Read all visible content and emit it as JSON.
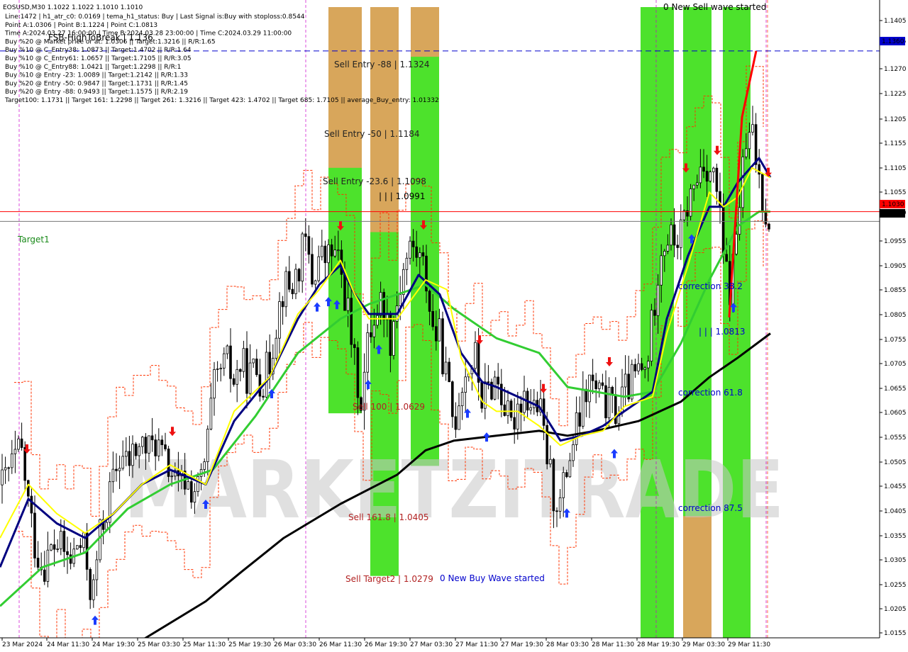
{
  "header": {
    "symbol_line": "EOSUSD,M30  1.1022 1.1022 1.1010 1.1010",
    "info_lines": [
      "Line:1472  |  h1_atr_c0: 0.0169  |  tema_h1_status: Buy  |  Last Signal is:Buy with stoploss:0.8544",
      "Point A:1.0306  |  Point B:1.1224  |  Point C:1.0813",
      "Time A:2024.03.27 16:00:00  |  Time B:2024.03.28 23:00:00  |  Time C:2024.03.29 11:00:00",
      "Buy %20 @ Market price or at: 1.0306  ||  Target:1.3216  ||  R/R:1.65",
      "Buy %10 @ C_Entry38: 1.0873  ||  Target:1.4702  ||  R/R:1.64",
      "Buy %10 @ C_Entry61: 1.0657  ||  Target:1.7105  ||  R/R:3.05",
      "Buy %10 @ C_Entry88: 1.0421  ||  Target:1.2298  ||  R/R:1",
      "Buy %10 @ Entry -23: 1.0089  ||  Target:1.2142  ||  R/R:1.33",
      "Buy %20 @ Entry -50: 0.9847  ||  Target:1.1731  ||  R/R:1.45",
      "Buy %20 @ Entry -88: 0.9493  ||  Target:1.1575  ||  R/R:2.19",
      "Target100: 1.1731  ||  Target 161: 1.2298  ||  Target 261: 1.3216  ||  Target 423: 1.4702  ||  Target 685: 1.7105  ||  average_Buy_entry: 1.01332"
    ]
  },
  "watermark": "MARKETZITRADE",
  "colors": {
    "bull_zone": "#3ee01a",
    "bear_zone": "#e8a060",
    "yellow_ma": "#ffff00",
    "navy_ma": "#000080",
    "green_ma": "#32cd32",
    "black_ma": "#000000",
    "channel": "#ff3300",
    "candle": "#000000",
    "hline_red": "#ff0000",
    "hline_blue": "#0000cc"
  },
  "annotations": [
    {
      "text": "0 New Sell wave started",
      "color": "#000000"
    },
    {
      "text": "Sell Entry -88 | 1.1324",
      "color": "#222222"
    },
    {
      "text": "Sell Entry -50 | 1.1184",
      "color": "#222222"
    },
    {
      "text": "Sell Entry -23.6 | 1.1098",
      "color": "#222222"
    },
    {
      "text": "| | | 1.0991",
      "color": "#000000"
    },
    {
      "text": "Target1",
      "color": "#1a8a1a"
    },
    {
      "text": "Sell 100 | 1.0629",
      "color": "#b22222"
    },
    {
      "text": "Sell 161.8 | 1.0405",
      "color": "#b22222"
    },
    {
      "text": "Sell Target2 | 1.0279",
      "color": "#b22222"
    },
    {
      "text": "0 New Buy Wave started",
      "color": "#0000cc"
    },
    {
      "text": "correction 38.2",
      "color": "#0000cc"
    },
    {
      "text": "| | | 1.0813",
      "color": "#0000cc"
    },
    {
      "text": "correction 61.8",
      "color": "#0000cc"
    },
    {
      "text": "correction 87.5",
      "color": "#0000cc"
    },
    {
      "text": "FSB-HighToBreak | 1.136",
      "color": "#000000"
    }
  ],
  "price_tags": [
    {
      "text": "1.1360",
      "bg": "#0000cc"
    },
    {
      "text": "1.1030",
      "bg": "#ff0000"
    },
    {
      "text": "1.1010",
      "bg": "#000000"
    }
  ],
  "chart_data": {
    "type": "candlestick",
    "timeframe": "M30",
    "ylim": [
      1.0155,
      1.145
    ],
    "y_ticks": [
      "1.1405",
      "1.1360",
      "1.1315",
      "1.1270",
      "1.1225",
      "1.1205",
      "1.1155",
      "1.1105",
      "1.1055",
      "1.1010",
      "1.0955",
      "1.0905",
      "1.0855",
      "1.0805",
      "1.0755",
      "1.0705",
      "1.0655",
      "1.0605",
      "1.0555",
      "1.0505",
      "1.0455",
      "1.0405",
      "1.0355",
      "1.0305",
      "1.0255",
      "1.0205",
      "1.0155"
    ],
    "x_ticks": [
      "23 Mar 2024",
      "24 Mar 11:30",
      "24 Mar 19:30",
      "25 Mar 03:30",
      "25 Mar 11:30",
      "25 Mar 19:30",
      "26 Mar 03:30",
      "26 Mar 11:30",
      "26 Mar 19:30",
      "27 Mar 03:30",
      "27 Mar 11:30",
      "27 Mar 19:30",
      "28 Mar 03:30",
      "28 Mar 11:30",
      "28 Mar 19:30",
      "29 Mar 03:30",
      "29 Mar 11:30"
    ],
    "horizontal_lines": [
      {
        "price": 1.136,
        "style": "dashed"
      },
      {
        "price": 1.103,
        "style": "solid"
      },
      {
        "price": 1.101,
        "style": "solid"
      }
    ],
    "close_path": [
      [
        0,
        1.046
      ],
      [
        10,
        1.049
      ],
      [
        20,
        1.052
      ],
      [
        30,
        1.054
      ],
      [
        40,
        1.043
      ],
      [
        50,
        1.034
      ],
      [
        60,
        1.03
      ],
      [
        70,
        1.033
      ],
      [
        80,
        1.035
      ],
      [
        90,
        1.033
      ],
      [
        100,
        1.031
      ],
      [
        110,
        1.035
      ],
      [
        120,
        1.033
      ],
      [
        130,
        1.023
      ],
      [
        140,
        1.036
      ],
      [
        150,
        1.042
      ],
      [
        160,
        1.048
      ],
      [
        170,
        1.053
      ],
      [
        180,
        1.051
      ],
      [
        190,
        1.054
      ],
      [
        200,
        1.055
      ],
      [
        210,
        1.054
      ],
      [
        220,
        1.056
      ],
      [
        230,
        1.052
      ],
      [
        240,
        1.05
      ],
      [
        250,
        1.046
      ],
      [
        260,
        1.048
      ],
      [
        270,
        1.046
      ],
      [
        280,
        1.046
      ],
      [
        290,
        1.052
      ],
      [
        300,
        1.066
      ],
      [
        310,
        1.07
      ],
      [
        320,
        1.072
      ],
      [
        330,
        1.068
      ],
      [
        340,
        1.072
      ],
      [
        350,
        1.069
      ],
      [
        360,
        1.071
      ],
      [
        370,
        1.068
      ],
      [
        380,
        1.072
      ],
      [
        390,
        1.081
      ],
      [
        400,
        1.088
      ],
      [
        410,
        1.087
      ],
      [
        420,
        1.091
      ],
      [
        430,
        1.097
      ],
      [
        440,
        1.089
      ],
      [
        450,
        1.094
      ],
      [
        460,
        1.093
      ],
      [
        470,
        1.095
      ],
      [
        480,
        1.091
      ],
      [
        490,
        1.083
      ],
      [
        500,
        1.071
      ],
      [
        510,
        1.064
      ],
      [
        520,
        1.078
      ],
      [
        530,
        1.083
      ],
      [
        540,
        1.085
      ],
      [
        550,
        1.077
      ],
      [
        560,
        1.085
      ],
      [
        570,
        1.092
      ],
      [
        580,
        1.096
      ],
      [
        590,
        1.094
      ],
      [
        600,
        1.09
      ],
      [
        610,
        1.079
      ],
      [
        620,
        1.077
      ],
      [
        630,
        1.068
      ],
      [
        640,
        1.059
      ],
      [
        650,
        1.068
      ],
      [
        660,
        1.071
      ],
      [
        670,
        1.073
      ],
      [
        680,
        1.064
      ],
      [
        690,
        1.067
      ],
      [
        700,
        1.069
      ],
      [
        710,
        1.064
      ],
      [
        720,
        1.058
      ],
      [
        730,
        1.064
      ],
      [
        740,
        1.066
      ],
      [
        750,
        1.063
      ],
      [
        760,
        1.063
      ],
      [
        770,
        1.054
      ],
      [
        780,
        1.045
      ],
      [
        790,
        1.043
      ],
      [
        800,
        1.051
      ],
      [
        810,
        1.057
      ],
      [
        820,
        1.062
      ],
      [
        830,
        1.068
      ],
      [
        840,
        1.066
      ],
      [
        850,
        1.064
      ],
      [
        860,
        1.063
      ],
      [
        870,
        1.062
      ],
      [
        880,
        1.066
      ],
      [
        890,
        1.068
      ],
      [
        900,
        1.07
      ],
      [
        910,
        1.07
      ],
      [
        920,
        1.081
      ],
      [
        930,
        1.095
      ],
      [
        940,
        1.098
      ],
      [
        950,
        1.097
      ],
      [
        960,
        1.098
      ],
      [
        970,
        1.105
      ],
      [
        980,
        1.108
      ],
      [
        990,
        1.114
      ],
      [
        1000,
        1.112
      ],
      [
        1010,
        1.108
      ],
      [
        1020,
        1.093
      ],
      [
        1030,
        1.086
      ],
      [
        1040,
        1.102
      ],
      [
        1050,
        1.115
      ],
      [
        1060,
        1.119
      ],
      [
        1070,
        1.11
      ],
      [
        1080,
        1.103
      ],
      [
        1086,
        1.101
      ]
    ],
    "yellow_ma": [
      [
        0,
        1.036
      ],
      [
        40,
        1.047
      ],
      [
        80,
        1.041
      ],
      [
        120,
        1.037
      ],
      [
        160,
        1.041
      ],
      [
        200,
        1.047
      ],
      [
        240,
        1.051
      ],
      [
        290,
        1.047
      ],
      [
        330,
        1.062
      ],
      [
        380,
        1.069
      ],
      [
        420,
        1.082
      ],
      [
        450,
        1.087
      ],
      [
        480,
        1.093
      ],
      [
        500,
        1.086
      ],
      [
        520,
        1.081
      ],
      [
        560,
        1.081
      ],
      [
        600,
        1.089
      ],
      [
        630,
        1.087
      ],
      [
        650,
        1.073
      ],
      [
        680,
        1.064
      ],
      [
        700,
        1.062
      ],
      [
        730,
        1.062
      ],
      [
        760,
        1.059
      ],
      [
        790,
        1.055
      ],
      [
        820,
        1.057
      ],
      [
        850,
        1.058
      ],
      [
        880,
        1.063
      ],
      [
        920,
        1.065
      ],
      [
        940,
        1.078
      ],
      [
        970,
        1.092
      ],
      [
        1000,
        1.107
      ],
      [
        1020,
        1.104
      ],
      [
        1040,
        1.106
      ],
      [
        1060,
        1.112
      ],
      [
        1086,
        1.11
      ]
    ],
    "navy_ma": [
      [
        0,
        1.03
      ],
      [
        40,
        1.044
      ],
      [
        80,
        1.039
      ],
      [
        120,
        1.036
      ],
      [
        160,
        1.041
      ],
      [
        200,
        1.047
      ],
      [
        240,
        1.05
      ],
      [
        290,
        1.047
      ],
      [
        330,
        1.06
      ],
      [
        380,
        1.069
      ],
      [
        420,
        1.081
      ],
      [
        450,
        1.088
      ],
      [
        480,
        1.092
      ],
      [
        500,
        1.086
      ],
      [
        520,
        1.082
      ],
      [
        560,
        1.082
      ],
      [
        590,
        1.09
      ],
      [
        620,
        1.086
      ],
      [
        650,
        1.074
      ],
      [
        680,
        1.068
      ],
      [
        700,
        1.067
      ],
      [
        730,
        1.065
      ],
      [
        760,
        1.063
      ],
      [
        790,
        1.056
      ],
      [
        820,
        1.057
      ],
      [
        850,
        1.059
      ],
      [
        880,
        1.062
      ],
      [
        920,
        1.066
      ],
      [
        940,
        1.081
      ],
      [
        970,
        1.094
      ],
      [
        1000,
        1.104
      ],
      [
        1020,
        1.104
      ],
      [
        1040,
        1.109
      ],
      [
        1070,
        1.114
      ],
      [
        1086,
        1.11
      ]
    ],
    "green_ma": [
      [
        0,
        1.022
      ],
      [
        60,
        1.03
      ],
      [
        120,
        1.033
      ],
      [
        180,
        1.042
      ],
      [
        240,
        1.047
      ],
      [
        300,
        1.05
      ],
      [
        360,
        1.061
      ],
      [
        420,
        1.074
      ],
      [
        480,
        1.081
      ],
      [
        520,
        1.084
      ],
      [
        560,
        1.086
      ],
      [
        600,
        1.088
      ],
      [
        640,
        1.083
      ],
      [
        700,
        1.077
      ],
      [
        760,
        1.074
      ],
      [
        800,
        1.067
      ],
      [
        840,
        1.066
      ],
      [
        880,
        1.065
      ],
      [
        920,
        1.066
      ],
      [
        960,
        1.076
      ],
      [
        1000,
        1.089
      ],
      [
        1040,
        1.1
      ],
      [
        1070,
        1.103
      ],
      [
        1086,
        1.103
      ]
    ],
    "black_ma": [
      [
        200,
        1.015
      ],
      [
        290,
        1.023
      ],
      [
        340,
        1.029
      ],
      [
        400,
        1.036
      ],
      [
        480,
        1.043
      ],
      [
        560,
        1.049
      ],
      [
        600,
        1.054
      ],
      [
        640,
        1.056
      ],
      [
        700,
        1.057
      ],
      [
        760,
        1.058
      ],
      [
        800,
        1.057
      ],
      [
        840,
        1.058
      ],
      [
        900,
        1.06
      ],
      [
        960,
        1.064
      ],
      [
        1000,
        1.069
      ],
      [
        1040,
        1.073
      ],
      [
        1086,
        1.078
      ]
    ],
    "zones": [
      {
        "x0": 463,
        "x1": 510,
        "y0": 1.145,
        "y1": 1.0616,
        "type": "bull"
      },
      {
        "x0": 463,
        "x1": 510,
        "y0": 1.145,
        "y1": 1.112,
        "type": "bear"
      },
      {
        "x0": 522,
        "x1": 562,
        "y0": 1.145,
        "y1": 1.0282,
        "type": "bull"
      },
      {
        "x0": 522,
        "x1": 562,
        "y0": 1.145,
        "y1": 1.0988,
        "type": "bear"
      },
      {
        "x0": 579,
        "x1": 619,
        "y0": 1.145,
        "y1": 1.0508,
        "type": "bull"
      },
      {
        "x0": 579,
        "x1": 619,
        "y0": 1.145,
        "y1": 1.1348,
        "type": "bear"
      },
      {
        "x0": 903,
        "x1": 950,
        "y0": 1.145,
        "y1": 1.0155,
        "type": "bull"
      },
      {
        "x0": 963,
        "x1": 1003,
        "y0": 1.145,
        "y1": 1.0155,
        "type": "bull"
      },
      {
        "x0": 963,
        "x1": 1003,
        "y0": 1.0405,
        "y1": 1.0155,
        "type": "bear"
      },
      {
        "x0": 1019,
        "x1": 1058,
        "y0": 1.145,
        "y1": 1.0155,
        "type": "bull"
      }
    ]
  }
}
